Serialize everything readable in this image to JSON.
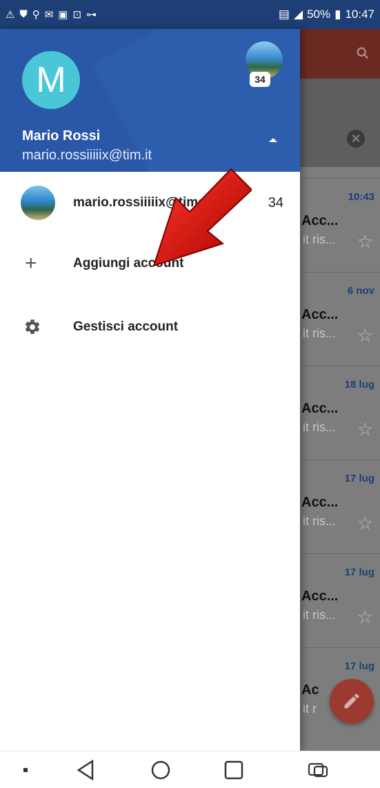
{
  "status_bar": {
    "battery": "50%",
    "time": "10:47"
  },
  "drawer": {
    "avatar_letter": "M",
    "badge_count": "34",
    "user_name": "Mario Rossi",
    "user_email": "mario.rossiiiiix@tim.it",
    "items": [
      {
        "label": "mario.rossiiiiix@timo...",
        "count": "34",
        "icon": "account-avatar-icon"
      },
      {
        "label": "Aggiungi account",
        "icon": "plus-icon"
      },
      {
        "label": "Gestisci account",
        "icon": "gear-icon"
      }
    ]
  },
  "mail_list": {
    "rows": [
      {
        "date": "10:43",
        "subject": "Acc...",
        "preview": "it ris..."
      },
      {
        "date": "6 nov",
        "subject": "Acc...",
        "preview": "it ris..."
      },
      {
        "date": "18 lug",
        "subject": "Acc...",
        "preview": "it ris..."
      },
      {
        "date": "17 lug",
        "subject": "Acc...",
        "preview": "it ris..."
      },
      {
        "date": "17 lug",
        "subject": "Acc...",
        "preview": "it ris..."
      },
      {
        "date": "17 lug",
        "subject": "Ac",
        "preview": "it r"
      }
    ]
  },
  "colors": {
    "header_blue": "#2a57a8",
    "status_bar": "#1e3f75",
    "avatar_teal": "#49c6d8",
    "fab_red": "#9c3a30",
    "annotation_red": "#d00000"
  }
}
